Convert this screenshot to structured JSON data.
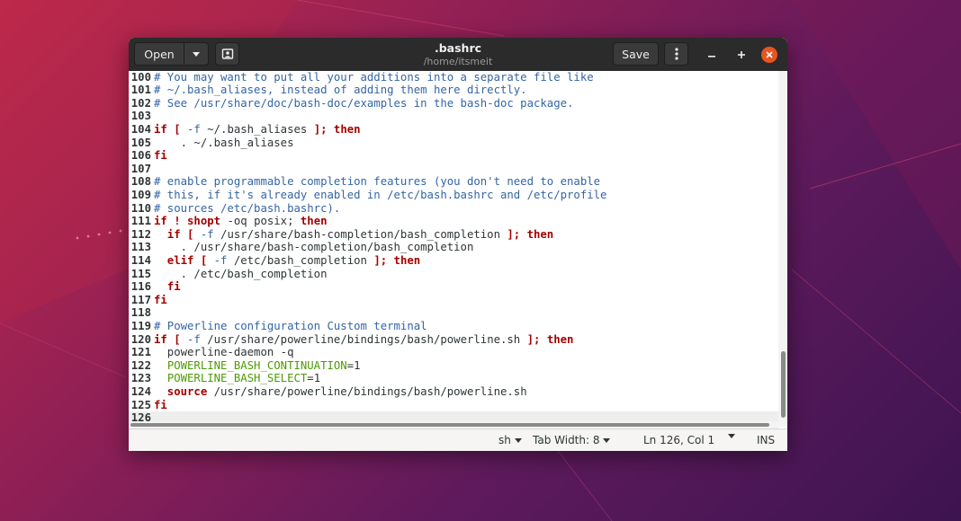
{
  "window": {
    "title": ".bashrc",
    "subtitle": "/home/itsmeit"
  },
  "headerbar": {
    "open_label": "Open",
    "save_label": "Save"
  },
  "editor": {
    "lines": [
      {
        "num": "100",
        "tokens": [
          {
            "t": "# You may want to put all your additions into a separate file like",
            "c": "comment"
          }
        ]
      },
      {
        "num": "101",
        "tokens": [
          {
            "t": "# ~/.bash_aliases, instead of adding them here directly.",
            "c": "comment"
          }
        ]
      },
      {
        "num": "102",
        "tokens": [
          {
            "t": "# See /usr/share/doc/bash-doc/examples in the bash-doc package.",
            "c": "comment"
          }
        ]
      },
      {
        "num": "103",
        "tokens": []
      },
      {
        "num": "104",
        "tokens": [
          {
            "t": "if [ ",
            "c": "keyword"
          },
          {
            "t": "-f",
            "c": "op"
          },
          {
            "t": " ~/.bash_aliases ",
            "c": "plain"
          },
          {
            "t": "]; then",
            "c": "keyword"
          }
        ]
      },
      {
        "num": "105",
        "tokens": [
          {
            "t": "    . ~/.bash_aliases",
            "c": "plain"
          }
        ]
      },
      {
        "num": "106",
        "tokens": [
          {
            "t": "fi",
            "c": "keyword"
          }
        ]
      },
      {
        "num": "107",
        "tokens": []
      },
      {
        "num": "108",
        "tokens": [
          {
            "t": "# enable programmable completion features (you don't need to enable",
            "c": "comment"
          }
        ]
      },
      {
        "num": "109",
        "tokens": [
          {
            "t": "# this, if it's already enabled in /etc/bash.bashrc and /etc/profile",
            "c": "comment"
          }
        ]
      },
      {
        "num": "110",
        "tokens": [
          {
            "t": "# sources /etc/bash.bashrc).",
            "c": "comment"
          }
        ]
      },
      {
        "num": "111",
        "tokens": [
          {
            "t": "if ! shopt",
            "c": "keyword"
          },
          {
            "t": " -oq posix; ",
            "c": "plain"
          },
          {
            "t": "then",
            "c": "keyword"
          }
        ]
      },
      {
        "num": "112",
        "tokens": [
          {
            "t": "  if [ ",
            "c": "keyword"
          },
          {
            "t": "-f",
            "c": "op"
          },
          {
            "t": " /usr/share/bash-completion/bash_completion ",
            "c": "plain"
          },
          {
            "t": "]; then",
            "c": "keyword"
          }
        ]
      },
      {
        "num": "113",
        "tokens": [
          {
            "t": "    . /usr/share/bash-completion/bash_completion",
            "c": "plain"
          }
        ]
      },
      {
        "num": "114",
        "tokens": [
          {
            "t": "  elif [ ",
            "c": "keyword"
          },
          {
            "t": "-f",
            "c": "op"
          },
          {
            "t": " /etc/bash_completion ",
            "c": "plain"
          },
          {
            "t": "]; then",
            "c": "keyword"
          }
        ]
      },
      {
        "num": "115",
        "tokens": [
          {
            "t": "    . /etc/bash_completion",
            "c": "plain"
          }
        ]
      },
      {
        "num": "116",
        "tokens": [
          {
            "t": "  fi",
            "c": "keyword"
          }
        ]
      },
      {
        "num": "117",
        "tokens": [
          {
            "t": "fi",
            "c": "keyword"
          }
        ]
      },
      {
        "num": "118",
        "tokens": []
      },
      {
        "num": "119",
        "tokens": [
          {
            "t": "# Powerline configuration Custom terminal",
            "c": "comment"
          }
        ]
      },
      {
        "num": "120",
        "tokens": [
          {
            "t": "if [ ",
            "c": "keyword"
          },
          {
            "t": "-f",
            "c": "op"
          },
          {
            "t": " /usr/share/powerline/bindings/bash/powerline.sh ",
            "c": "plain"
          },
          {
            "t": "]; then",
            "c": "keyword"
          }
        ]
      },
      {
        "num": "121",
        "tokens": [
          {
            "t": "  powerline-daemon -q",
            "c": "plain"
          }
        ]
      },
      {
        "num": "122",
        "tokens": [
          {
            "t": "  ",
            "c": "plain"
          },
          {
            "t": "POWERLINE_BASH_CONTINUATION",
            "c": "var"
          },
          {
            "t": "=1",
            "c": "plain"
          }
        ]
      },
      {
        "num": "123",
        "tokens": [
          {
            "t": "  ",
            "c": "plain"
          },
          {
            "t": "POWERLINE_BASH_SELECT",
            "c": "var"
          },
          {
            "t": "=1",
            "c": "plain"
          }
        ]
      },
      {
        "num": "124",
        "tokens": [
          {
            "t": "  source",
            "c": "keyword"
          },
          {
            "t": " /usr/share/powerline/bindings/bash/powerline.sh",
            "c": "plain"
          }
        ]
      },
      {
        "num": "125",
        "tokens": [
          {
            "t": "fi",
            "c": "keyword"
          }
        ]
      },
      {
        "num": "126",
        "tokens": [],
        "current": true
      }
    ]
  },
  "statusbar": {
    "language": "sh",
    "tab_width": "Tab Width: 8",
    "position": "Ln 126, Col 1",
    "mode": "INS"
  },
  "colors": {
    "comment": "#3465a4",
    "keyword": "#a40000",
    "variable": "#4e9a06",
    "close_button": "#e95420"
  },
  "icons": [
    "chevron-down-icon",
    "browse-files-icon",
    "hamburger-menu-icon",
    "minimize-icon",
    "maximize-icon",
    "close-icon"
  ]
}
